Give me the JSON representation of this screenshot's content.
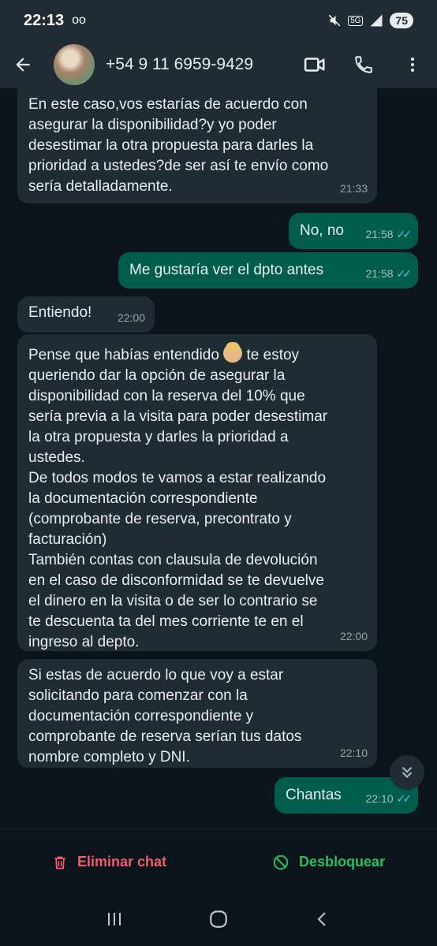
{
  "status_bar": {
    "time": "22:13",
    "voicemail_icon": "oo",
    "network": "5G",
    "battery": "75"
  },
  "header": {
    "contact": "+54 9 11 6959-9429"
  },
  "messages": [
    {
      "dir": "in",
      "text": "En este caso,vos estarías de acuerdo con\nasegurar la disponibilidad?y yo poder\ndesestimar la otra propuesta para darles la\nprioridad a ustedes?de ser así te envío como\nsería detalladamente.",
      "time": "21:33"
    },
    {
      "dir": "out",
      "text": "No, no",
      "time": "21:58",
      "status": "read"
    },
    {
      "dir": "out",
      "text": "Me gustaría ver el dpto antes",
      "time": "21:58",
      "status": "read"
    },
    {
      "dir": "in",
      "text": "Entiendo!",
      "time": "22:00"
    },
    {
      "dir": "in",
      "text_before_emoji": "Pense que habías entendido ",
      "emoji": "person-facepalming",
      "text_after_emoji": " te estoy",
      "text": "queriendo dar la opción de asegurar la\ndisponibilidad con la reserva del 10% que\nsería previa a la visita para poder desestimar\nla otra propuesta y darles la prioridad a\nustedes.\nDe todos modos te vamos a estar realizando\nla documentación correspondiente\n(comprobante de reserva, precontrato y\nfacturación)\nTambién contas con clausula de devolución\nen el caso de disconformidad se te devuelve\nel dinero en la visita o de ser lo contrario se\nte descuenta ta del mes corriente te en el\ningreso al depto.",
      "time": "22:00"
    },
    {
      "dir": "in",
      "text": "Si estas de acuerdo lo que voy a estar\nsolicitando para comenzar con la\ndocumentación correspondiente y\ncomprobante de reserva serían tus datos\nnombre completo y DNI.",
      "time": "22:10"
    },
    {
      "dir": "out",
      "text": "Chantas",
      "time": "22:10",
      "status": "read"
    }
  ],
  "actions": {
    "delete_label": "Eliminar chat",
    "unblock_label": "Desbloquear"
  },
  "colors": {
    "incoming_bubble": "#202c33",
    "outgoing_bubble": "#005c4b",
    "delete": "#f15c6d",
    "unblock": "#21c063",
    "read_ticks": "#53bdeb"
  }
}
